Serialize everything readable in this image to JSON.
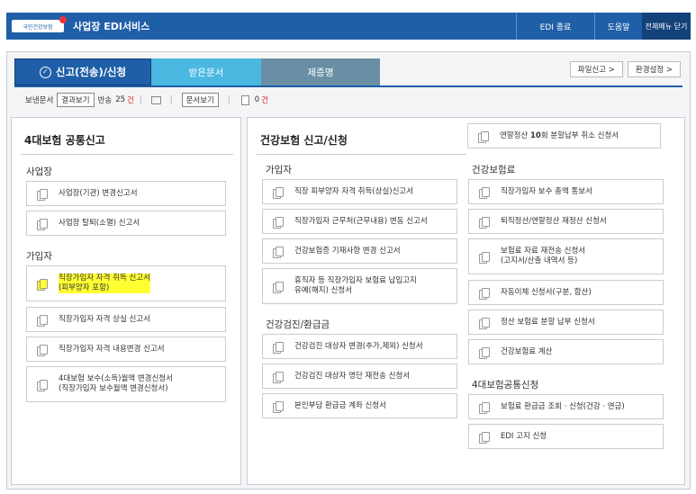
{
  "header": {
    "logo_text": "국민건강보험",
    "title": "사업장 EDI서비스",
    "edi_end": "EDI 종료",
    "help": "도움말",
    "close_all": "전체메뉴 닫기"
  },
  "tabs": [
    {
      "label": "신고(전송)/신청",
      "active": true
    },
    {
      "label": "받은문서"
    },
    {
      "label": "제증명"
    }
  ],
  "right_buttons": {
    "file_report": "파일신고 >",
    "env_settings": "환경설정 >"
  },
  "status": {
    "sent_label": "보낸문서",
    "result_view": "결과보기",
    "returned_label": "반송",
    "returned_count": "25",
    "returned_unit": "건",
    "doc_view": "문서보기",
    "doc_count": "0",
    "doc_unit": "건"
  },
  "left_panel": {
    "title": "4대보험 공통신고",
    "section_workplace": "사업장",
    "workplace_items": [
      "사업장(기관) 변경신고서",
      "사업장 탈퇴(소멸) 신고서"
    ],
    "section_subscriber": "가입자",
    "subscriber_items": [
      "직장가입자 자격 취득 신고서\n(피부양자 포함)",
      "직장가입자 자격 상실 신고서",
      "직장가입자 자격 내용변경 신고서",
      "4대보험 보수(소득)월액 변경신청서\n(직장가입자 보수월액 변경신청서)"
    ]
  },
  "right_panel": {
    "title": "건강보험 신고/신청",
    "top_item_prefix": "연말정산 ",
    "top_item_bold": "10",
    "top_item_suffix": "회 분할납부 취소 신청서",
    "section_subscriber": "가입자",
    "subscriber_items": [
      "직장 피부양자 자격 취득(상실)신고서",
      "직장가입자 근무처(근무내용) 변동 신고서",
      "건강보험증 기재사항 변경 신고서",
      "휴직자 등 직장가입자 보험료 납입고지\n유예(해지) 신청서"
    ],
    "section_checkup": "건강검진/환급금",
    "checkup_items": [
      "건강검진 대상자 변경(추가,제외) 신청서",
      "건강검진 대상자 명단 재전송 신청서",
      "본인부담 환급금 계좌 신청서"
    ],
    "section_premium": "건강보험료",
    "premium_items": [
      "직장가입자 보수 총액 통보서",
      "퇴직정산/연말정산 재정산 신청서",
      "보험료 자료 재전송 신청서\n(고지서/산출 내역서 등)",
      "자동이체 신청서(구분, 합산)",
      "정산 보험료 분할 납부 신청서",
      "건강보험료 계산"
    ],
    "section_common": "4대보험공통신청",
    "common_items": [
      "보험료 환급금 조회 · 신청(건강 · 연금)",
      "EDI 고지 신청"
    ]
  },
  "colors": {
    "header_blue": "#1f5fa8",
    "tab_received": "#4ab8e0",
    "tab_submit": "#6a8fa5",
    "highlight": "#ffff33",
    "count_red": "#dd2222"
  }
}
